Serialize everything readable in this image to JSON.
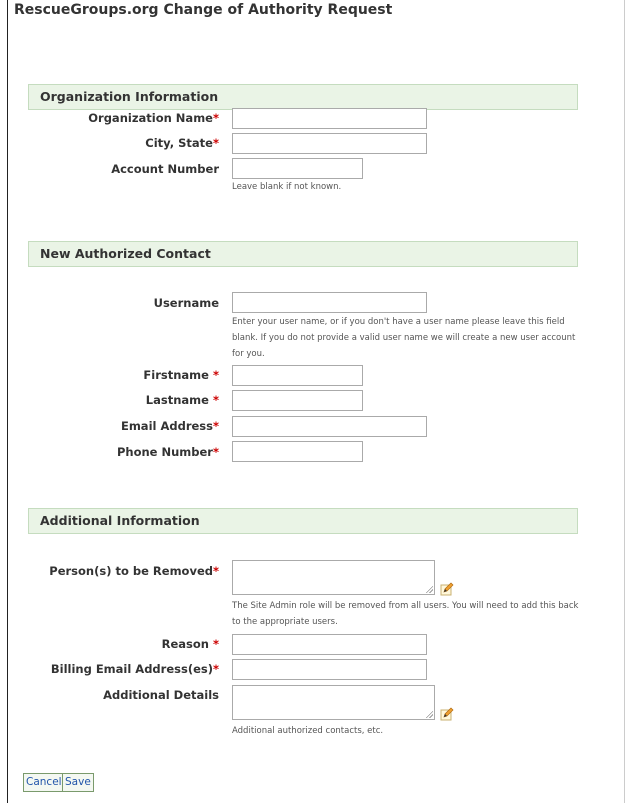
{
  "page": {
    "title": "RescueGroups.org Change of Authority Request"
  },
  "sections": {
    "organization": {
      "header": "Organization Information",
      "org_name_label": "Organization Name",
      "city_state_label": "City, State",
      "account_number_label": "Account Number",
      "account_number_help": "Leave blank if not known."
    },
    "contact": {
      "header": "New Authorized Contact",
      "username_label": "Username",
      "username_help": "Enter your user name, or if you don't have a user name please leave this field blank. If you do not provide a valid user name we will create a new user account for you.",
      "firstname_label": "Firstname",
      "lastname_label": "Lastname",
      "email_label": "Email Address",
      "phone_label": "Phone Number"
    },
    "additional": {
      "header": "Additional Information",
      "persons_removed_label": "Person(s) to be Removed",
      "persons_removed_help": "The Site Admin role will be removed from all users. You will need to add this back to the appropriate users.",
      "reason_label": "Reason",
      "billing_email_label": "Billing Email Address(es)",
      "additional_details_label": "Additional Details",
      "additional_details_help": "Additional authorized contacts, etc."
    }
  },
  "required_marker": "*",
  "actions": {
    "cancel_label": "Cancel",
    "save_label": "Save"
  },
  "colors": {
    "section_header_bg": "#eaf4e6",
    "section_header_border": "#c5dcbf",
    "required": "#cc0000",
    "button_text": "#2255aa"
  },
  "icons": {
    "edit": "pencil-edit-icon",
    "resize": "resize-grip-icon"
  }
}
